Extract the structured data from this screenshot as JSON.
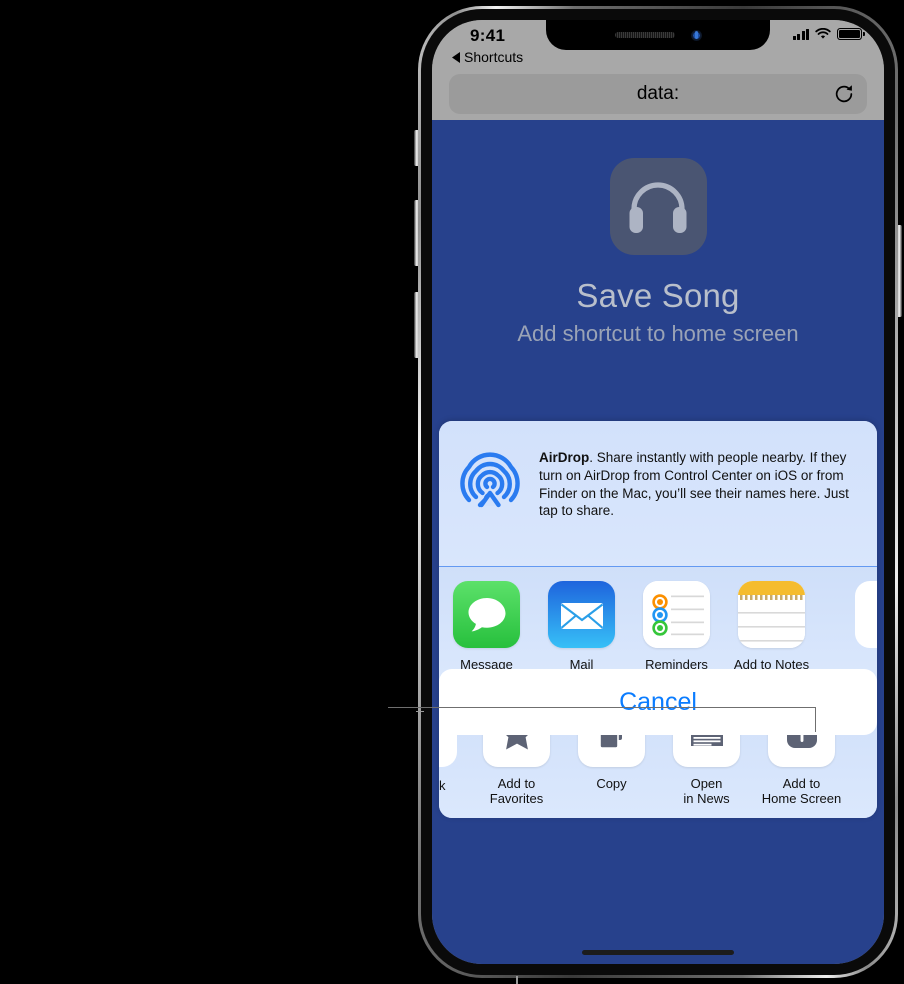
{
  "status_bar": {
    "time": "9:41",
    "back_label": "Shortcuts",
    "back_icon": "triangle-left-icon",
    "signal_icon": "cellular-bars-icon",
    "wifi_icon": "wifi-icon",
    "battery_icon": "battery-full-icon"
  },
  "browser": {
    "url": "data:",
    "reload_icon": "reload-icon"
  },
  "page": {
    "app_icon": "headphones-icon",
    "title": "Save Song",
    "subtitle": "Add shortcut to home screen",
    "background_color": "#27418C"
  },
  "share_sheet": {
    "airdrop": {
      "icon": "airdrop-icon",
      "title": "AirDrop",
      "description": ". Share instantly with people nearby. If they turn on AirDrop from Control Center on iOS or from Finder on the Mac, you’ll see their names here. Just tap to share."
    },
    "apps": [
      {
        "label": "Message",
        "icon": "messages-icon"
      },
      {
        "label": "Mail",
        "icon": "mail-icon"
      },
      {
        "label": "Reminders",
        "icon": "reminders-icon"
      },
      {
        "label": "Add to Notes",
        "icon": "notes-icon"
      }
    ],
    "actions_partial_left_label": "k",
    "actions": [
      {
        "label": "Add to\nFavorites",
        "line1": "Add to",
        "line2": "Favorites",
        "icon": "star-icon"
      },
      {
        "label": "Copy",
        "line1": "Copy",
        "line2": "",
        "icon": "copy-icon"
      },
      {
        "label": "Open in News",
        "line1": "Open",
        "line2": "in News",
        "icon": "news-icon"
      },
      {
        "label": "Add to Home Screen",
        "line1": "Add to",
        "line2": "Home Screen",
        "icon": "add-to-home-screen-icon"
      }
    ],
    "cancel_label": "Cancel",
    "cancel_color": "#0A7CFF"
  },
  "annotation": {
    "callout_target": "Add to Home Screen",
    "line_color": "#6F6F6F"
  }
}
